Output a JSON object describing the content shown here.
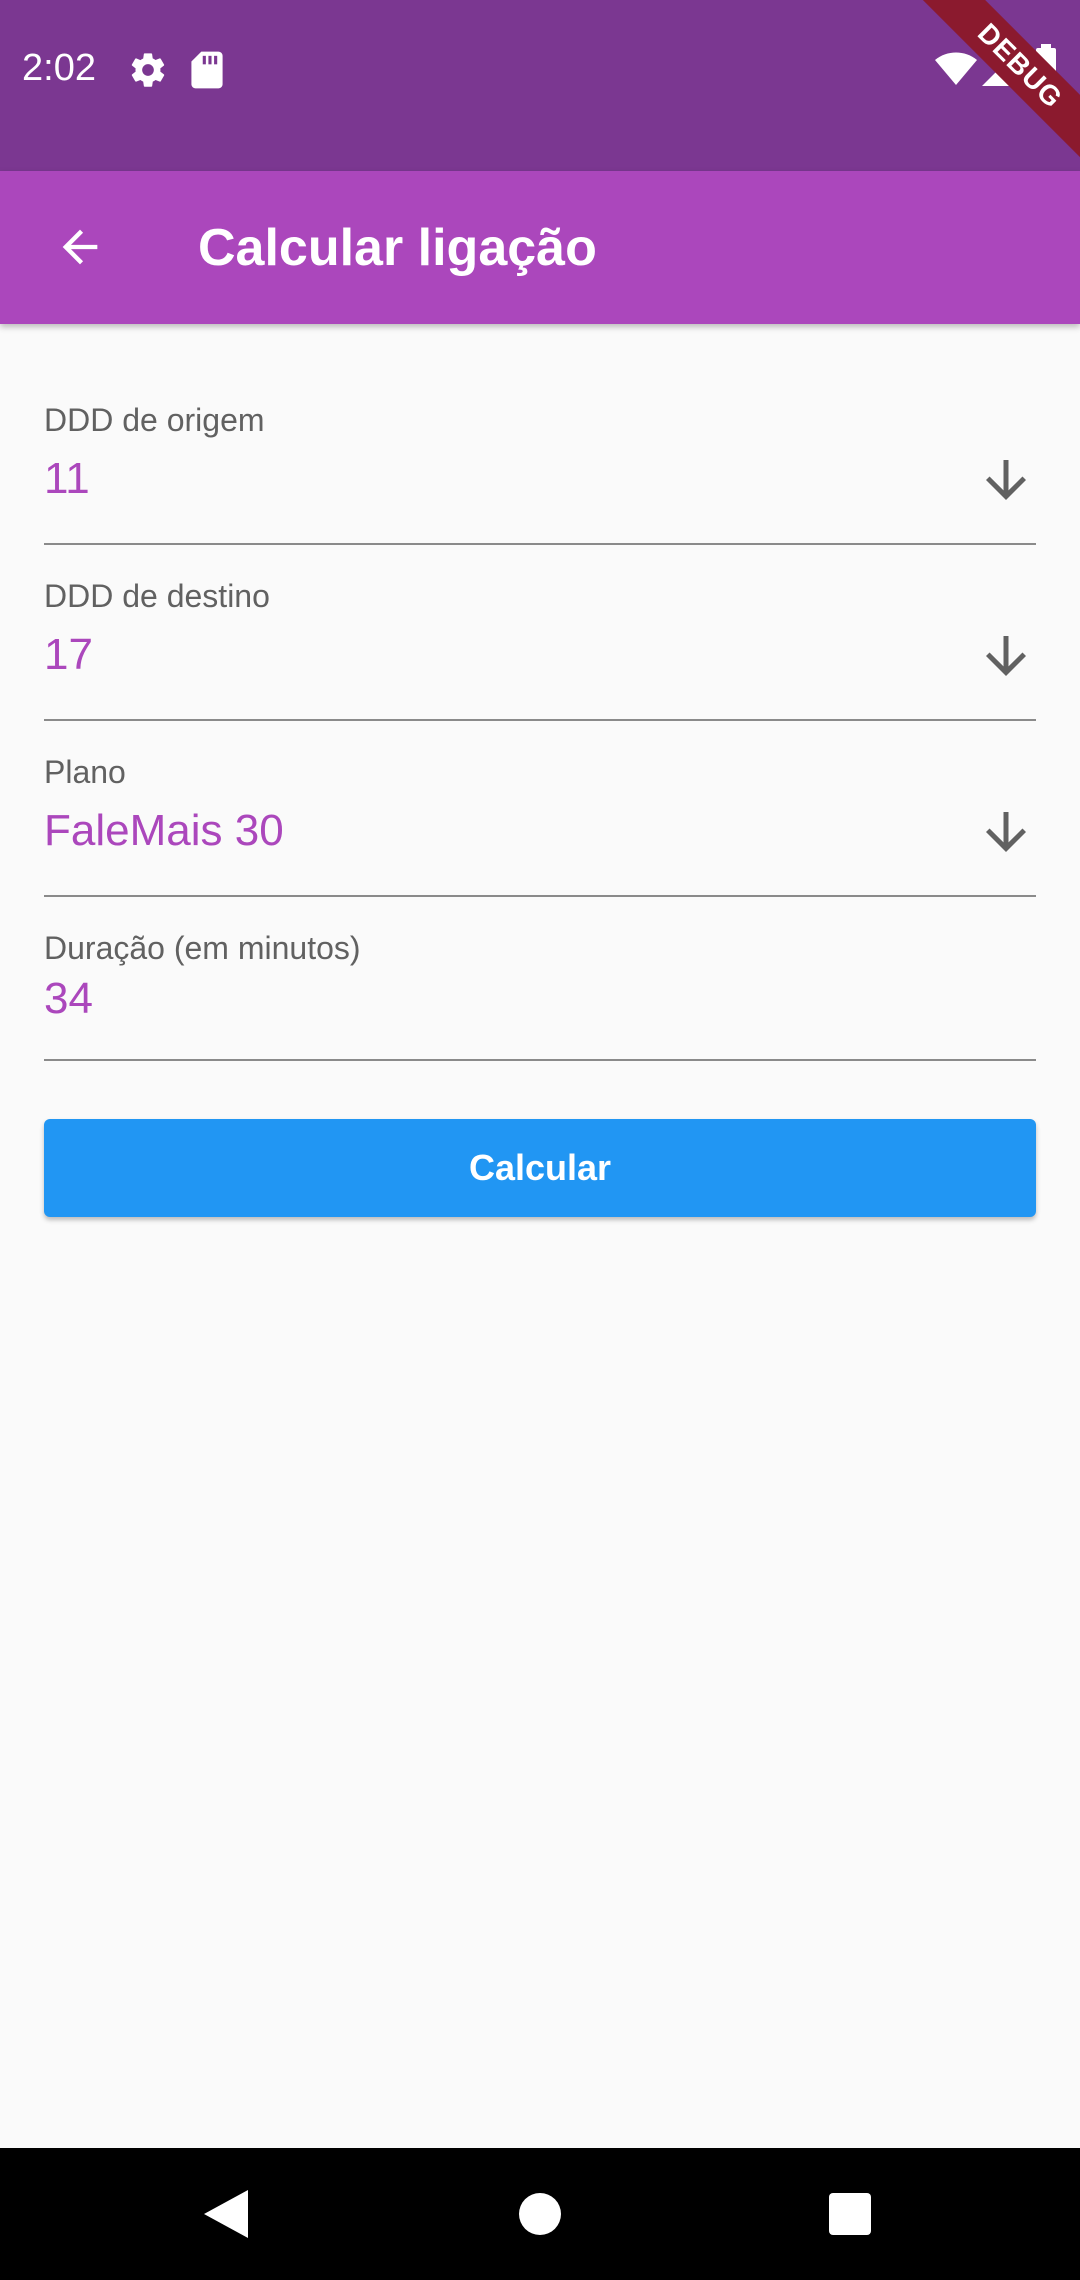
{
  "status_bar": {
    "time": "2:02",
    "icons": [
      "gear-icon",
      "sd-card-icon",
      "wifi-icon",
      "cell-signal-icon",
      "battery-icon"
    ],
    "debug_label": "DEBUG"
  },
  "app_bar": {
    "title": "Calcular ligação",
    "back_icon": "arrow-back-icon"
  },
  "form": {
    "ddd_origem": {
      "label": "DDD de origem",
      "value": "11"
    },
    "ddd_destino": {
      "label": "DDD de destino",
      "value": "17"
    },
    "plano": {
      "label": "Plano",
      "value": "FaleMais 30"
    },
    "duracao": {
      "label": "Duração (em minutos)",
      "value": "34"
    },
    "submit_label": "Calcular"
  },
  "nav_bar": {
    "icons": [
      "back-triangle-icon",
      "home-circle-icon",
      "recents-square-icon"
    ]
  },
  "colors": {
    "status_bar": "#7b3791",
    "app_bar": "#ab47bc",
    "accent_text": "#ab47bc",
    "button": "#2196f3",
    "background": "#fafafa"
  }
}
